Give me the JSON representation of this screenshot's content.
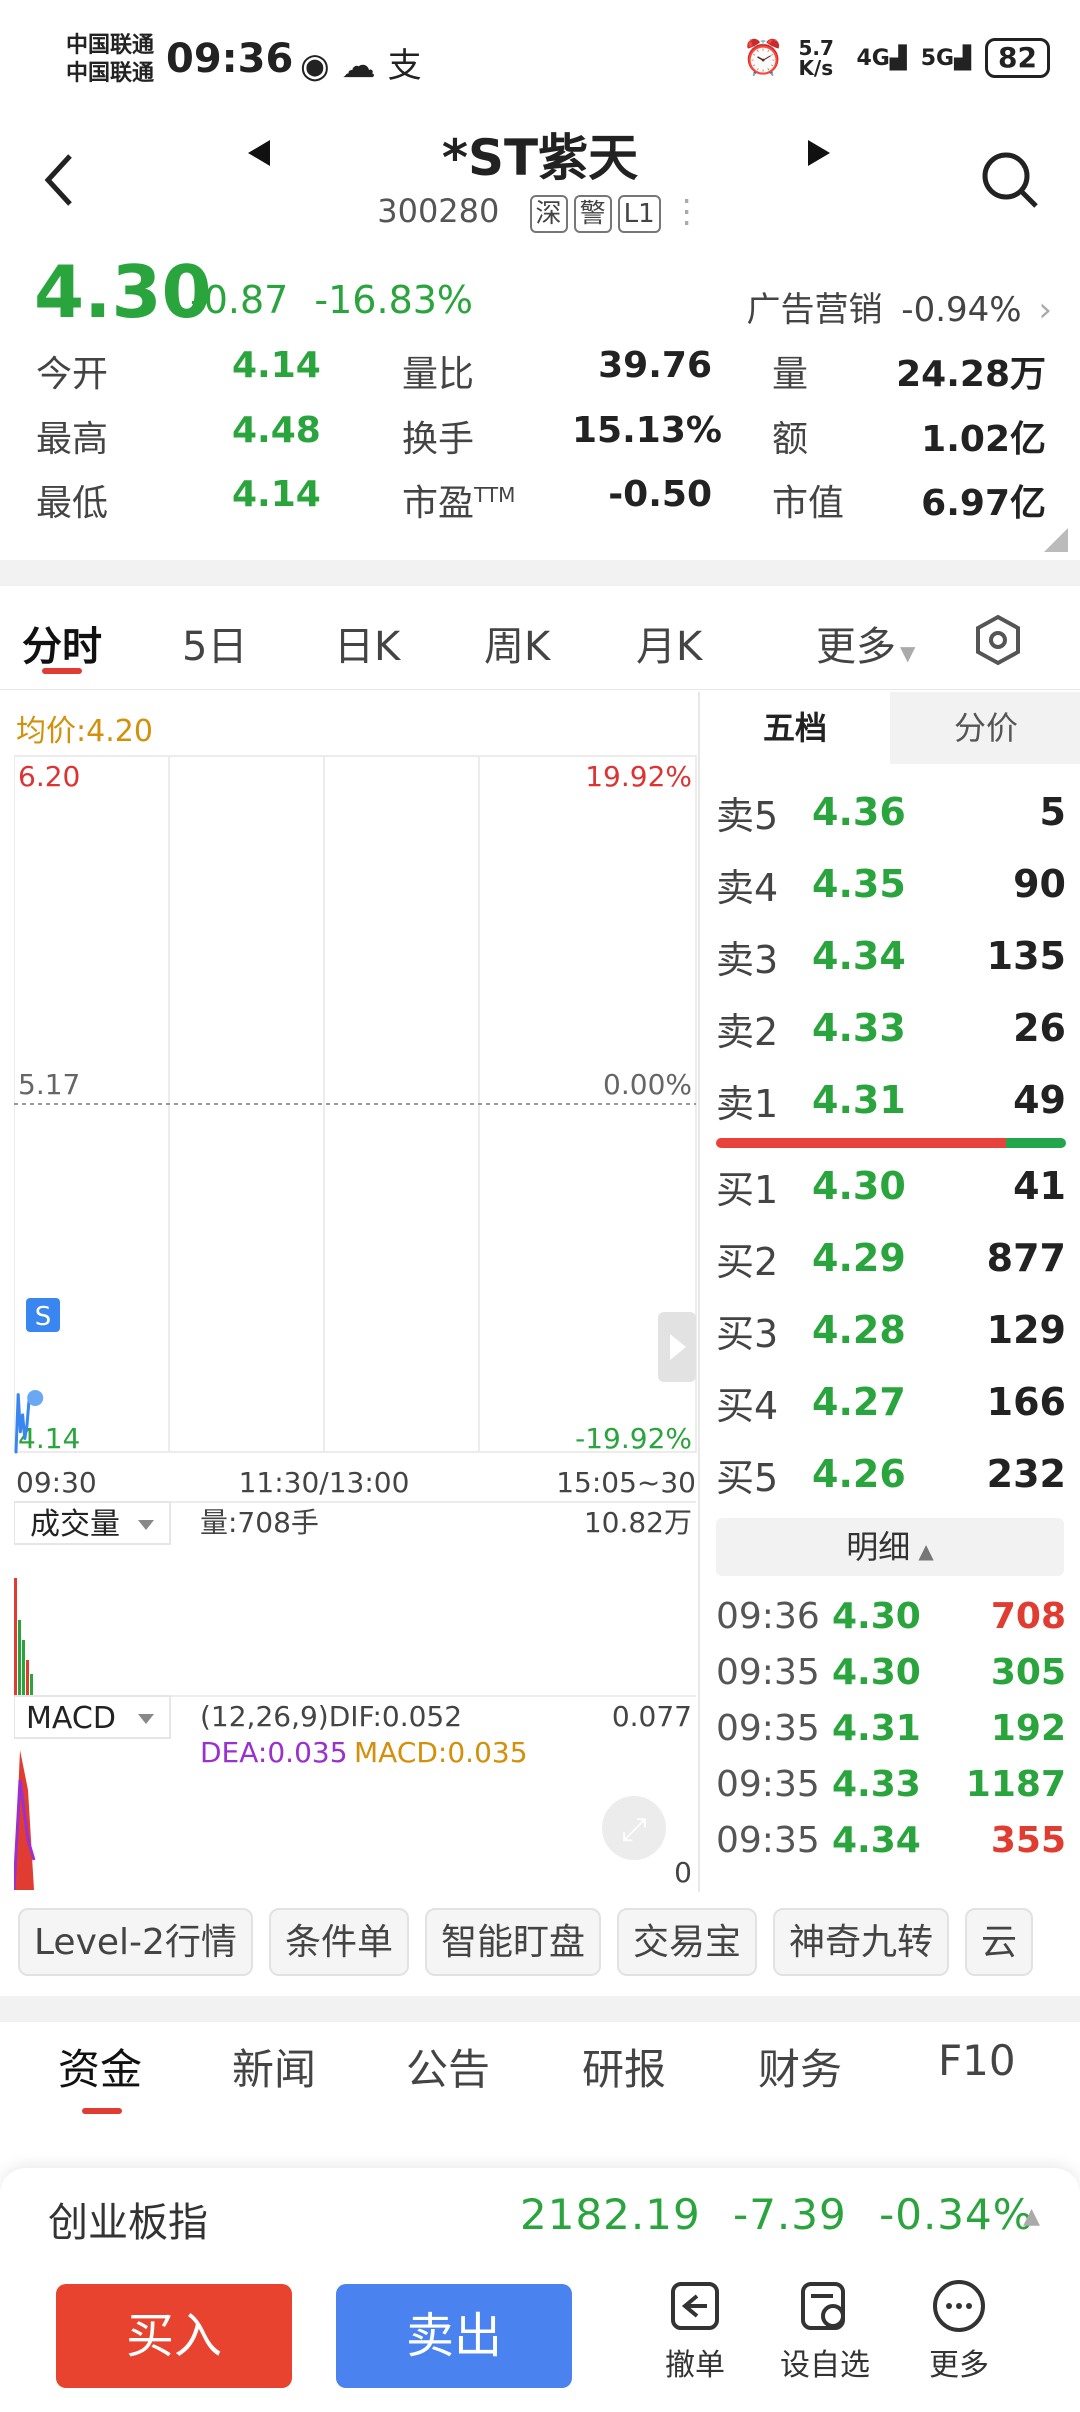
{
  "status_bar": {
    "carrier1": "中国联通",
    "carrier2": "中国联通",
    "time": "09:36",
    "net_speed": "5.7 K/s",
    "battery": "82",
    "icons": [
      "eye-icon",
      "wechat-icon",
      "alipay-icon",
      "alarm-icon",
      "signal-4g-icon",
      "signal-5g-icon",
      "battery-icon"
    ]
  },
  "header": {
    "title": "*ST紫天",
    "code": "300280",
    "tags": [
      "深",
      "警",
      "L1"
    ]
  },
  "quote": {
    "price": "4.30",
    "change": "-0.87",
    "change_pct": "-16.83%",
    "sector_name": "广告营销",
    "sector_pct": "-0.94%",
    "stats": [
      {
        "label": "今开",
        "value": "4.14"
      },
      {
        "label": "量比",
        "value": "39.76"
      },
      {
        "label": "量",
        "value": "24.28万"
      },
      {
        "label": "最高",
        "value": "4.48"
      },
      {
        "label": "换手",
        "value": "15.13%"
      },
      {
        "label": "额",
        "value": "1.02亿"
      },
      {
        "label": "最低",
        "value": "4.14"
      },
      {
        "label": "市盈",
        "value": "-0.50"
      },
      {
        "label": "市值",
        "value": "6.97亿"
      }
    ],
    "pe_suffix": "TTM"
  },
  "chart_tabs": [
    "分时",
    "5日",
    "日K",
    "周K",
    "月K",
    "更多"
  ],
  "chart": {
    "avg_label": "均价:4.20",
    "y_top": "6.20",
    "y_mid": "5.17",
    "y_bot": "4.14",
    "pct_top": "19.92%",
    "pct_mid": "0.00%",
    "pct_bot": "-19.92%",
    "x_start": "09:30",
    "x_mid": "11:30/13:00",
    "x_end": "15:05~30",
    "marker": "S",
    "volume_label": "成交量",
    "volume_text": "量:708手",
    "volume_max": "10.82万",
    "macd_label": "MACD",
    "macd_params": "(12,26,9)DIF:0.052",
    "dea": "DEA:0.035",
    "macd_val": "MACD:0.035",
    "macd_top": "0.077",
    "macd_bot": "0"
  },
  "chart_data": {
    "type": "line",
    "x": [
      "09:30",
      "09:31",
      "09:32",
      "09:33",
      "09:34",
      "09:35",
      "09:36"
    ],
    "series": [
      {
        "values": [
          4.14,
          4.31,
          4.2,
          4.25,
          4.18,
          4.22,
          4.3
        ]
      }
    ],
    "ylim": [
      4.14,
      6.2
    ],
    "xticks": [
      "09:30",
      "11:30/13:00",
      "15:05~30"
    ]
  },
  "orderbook": {
    "tab_active": "五档",
    "tab_other": "分价",
    "asks": [
      {
        "label": "卖5",
        "price": "4.36",
        "qty": "5"
      },
      {
        "label": "卖4",
        "price": "4.35",
        "qty": "90"
      },
      {
        "label": "卖3",
        "price": "4.34",
        "qty": "135"
      },
      {
        "label": "卖2",
        "price": "4.33",
        "qty": "26"
      },
      {
        "label": "卖1",
        "price": "4.31",
        "qty": "49"
      }
    ],
    "bids": [
      {
        "label": "买1",
        "price": "4.30",
        "qty": "41"
      },
      {
        "label": "买2",
        "price": "4.29",
        "qty": "877"
      },
      {
        "label": "买3",
        "price": "4.28",
        "qty": "129"
      },
      {
        "label": "买4",
        "price": "4.27",
        "qty": "166"
      },
      {
        "label": "买5",
        "price": "4.26",
        "qty": "232"
      }
    ],
    "detail_label": "明细",
    "ticks": [
      {
        "time": "09:36",
        "price": "4.30",
        "qty": "708",
        "color": "#e03c31"
      },
      {
        "time": "09:35",
        "price": "4.30",
        "qty": "305",
        "color": "#2aa43c"
      },
      {
        "time": "09:35",
        "price": "4.31",
        "qty": "192",
        "color": "#2aa43c"
      },
      {
        "time": "09:35",
        "price": "4.33",
        "qty": "1187",
        "color": "#2aa43c"
      },
      {
        "time": "09:35",
        "price": "4.34",
        "qty": "355",
        "color": "#e03c31"
      }
    ]
  },
  "tools": [
    "Level-2行情",
    "条件单",
    "智能盯盘",
    "交易宝",
    "神奇九转",
    "云"
  ],
  "bottom_tabs": [
    "资金",
    "新闻",
    "公告",
    "研报",
    "财务",
    "F10"
  ],
  "index_bar": {
    "name": "创业板指",
    "value": "2182.19",
    "change": "-7.39",
    "pct": "-0.34%"
  },
  "actions": {
    "buy": "买入",
    "sell": "卖出",
    "cancel": "撤单",
    "watchlist": "设自选",
    "more": "更多"
  },
  "colors": {
    "up": "#e03c31",
    "down": "#2aa43c",
    "buy_button": "#e8432e",
    "sell_button": "#4a82f0",
    "avg_line": "#d4900a"
  }
}
